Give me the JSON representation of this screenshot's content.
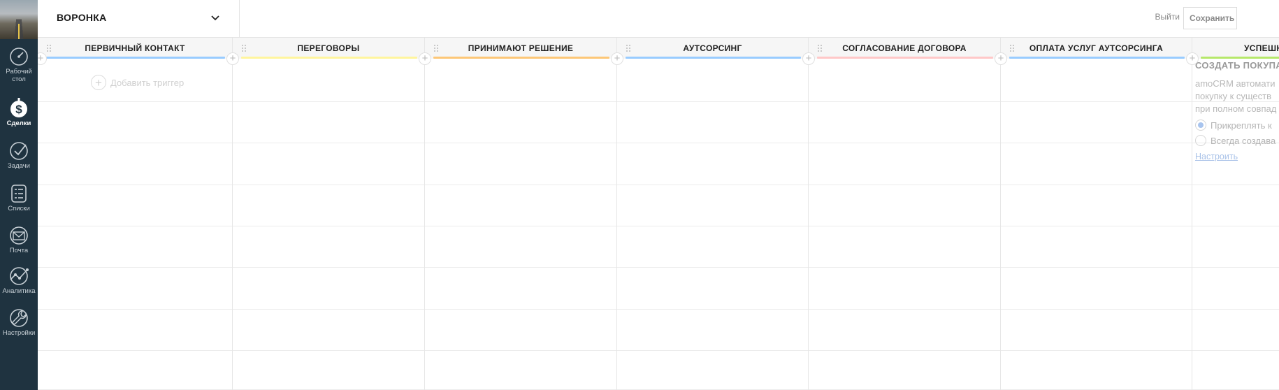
{
  "header": {
    "pipeline_title": "ВОРОНКА",
    "exit_label": "Выйти",
    "save_label": "Сохранить"
  },
  "sidebar": {
    "items": [
      {
        "label_line1": "Рабочий",
        "label_line2": "стол",
        "icon": "dashboard-icon"
      },
      {
        "label_line1": "Сделки",
        "label_line2": "",
        "icon": "deals-icon",
        "active": true
      },
      {
        "label_line1": "Задачи",
        "label_line2": "",
        "icon": "tasks-icon"
      },
      {
        "label_line1": "Списки",
        "label_line2": "",
        "icon": "lists-icon"
      },
      {
        "label_line1": "Почта",
        "label_line2": "",
        "icon": "mail-icon"
      },
      {
        "label_line1": "Аналитика",
        "label_line2": "",
        "icon": "analytics-icon"
      },
      {
        "label_line1": "Настройки",
        "label_line2": "",
        "icon": "settings-icon"
      }
    ]
  },
  "columns": [
    {
      "name": "ПЕРВИЧНЫЙ КОНТАКТ",
      "color": "#99ccff"
    },
    {
      "name": "ПЕРЕГОВОРЫ",
      "color": "#fff59d"
    },
    {
      "name": "ПРИНИМАЮТ РЕШЕНИЕ",
      "color": "#fdc777"
    },
    {
      "name": "АУТСОРСИНГ",
      "color": "#99ccff"
    },
    {
      "name": "СОГЛАСОВАНИЕ ДОГОВОРА",
      "color": "#ffc8c8"
    },
    {
      "name": "ОПЛАТА УСЛУГ АУТСОРСИНГА",
      "color": "#99ccff"
    },
    {
      "name": "УСПЕШНО Р",
      "color": "#b6e86a"
    }
  ],
  "add_trigger_label": "Добавить триггер",
  "success_panel": {
    "title": "СОЗДАТЬ ПОКУПА",
    "desc_line1": "amoCRM автомати",
    "desc_line2": "покупку к существ",
    "desc_line3": "при полном совпад",
    "option1": "Прикреплять к",
    "option2": "Всегда создава",
    "link": "Настроить"
  }
}
